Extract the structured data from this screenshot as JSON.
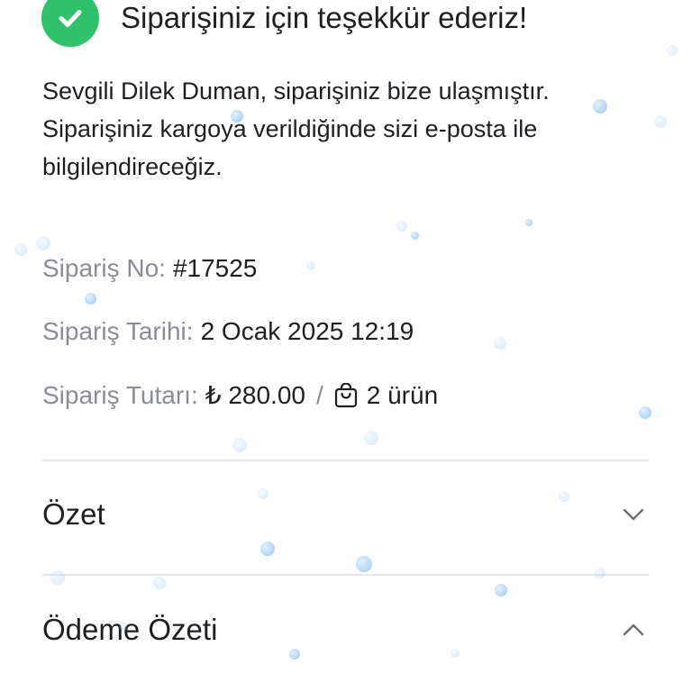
{
  "header": {
    "title": "Siparişiniz için teşekkür ederiz!",
    "icon": "check-circle-icon",
    "icon_color": "#2ec26b"
  },
  "message": {
    "text": "Sevgili Dilek Duman, siparişiniz bize ulaşmıştır. Siparişiniz kargoya verildiğinde sizi e-posta ile bilgilendireceğiz."
  },
  "order": {
    "number_label": "Sipariş No:",
    "number_value": "#17525",
    "date_label": "Sipariş Tarihi:",
    "date_value": "2 Ocak 2025 12:19",
    "total_label": "Sipariş Tutarı:",
    "total_value": "₺ 280.00",
    "separator": "/",
    "items_icon": "shopping-bag-icon",
    "items_value": "2 ürün"
  },
  "sections": {
    "summary": {
      "title": "Özet",
      "state": "collapsed",
      "icon": "chevron-down-icon"
    },
    "payment_summary": {
      "title": "Ödeme Özeti",
      "state": "expanded",
      "icon": "chevron-up-icon"
    }
  },
  "colors": {
    "label": "#8a8d94",
    "text": "#1f1f23",
    "divider": "#e6e7ea"
  }
}
